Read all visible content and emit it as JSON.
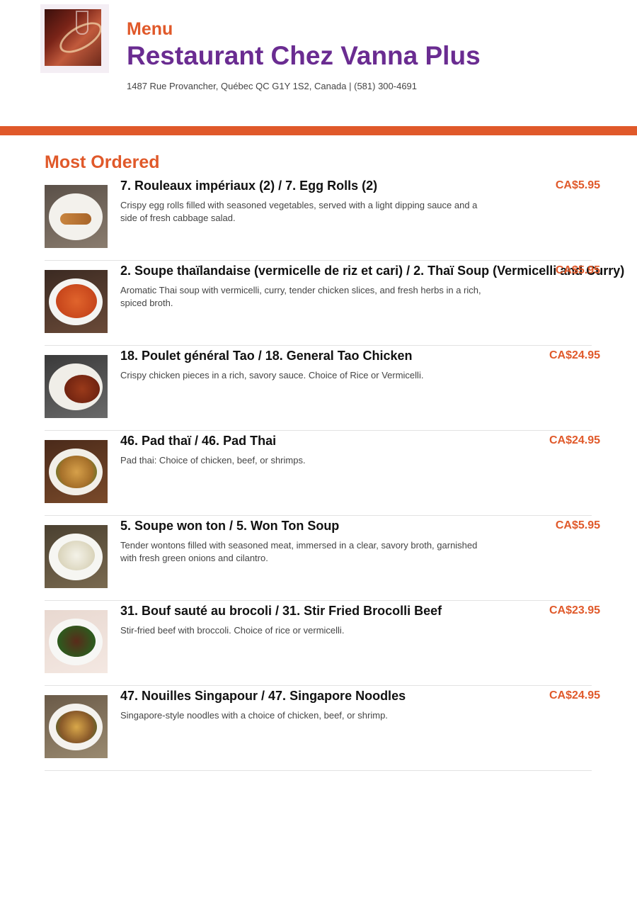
{
  "header": {
    "menu_label": "Menu",
    "restaurant_name": "Restaurant Chez Vanna Plus",
    "address_line": "1487 Rue Provancher, Québec QC G1Y 1S2, Canada | (581) 300-4691",
    "accent_color": "#e0592a",
    "title_color": "#6a2c91"
  },
  "section": {
    "title": "Most Ordered"
  },
  "items": [
    {
      "name": "7. Rouleaux impériaux (2) / 7. Egg Rolls (2)",
      "description": "Crispy egg rolls filled with seasoned vegetables, served with a light dipping sauce and a side of fresh cabbage salad.",
      "price": "CA$5.95"
    },
    {
      "name": "2. Soupe thaïlandaise (vermicelle de riz et cari) / 2. Thaï Soup (Vermicelli and Curry)",
      "description": "Aromatic Thai soup with vermicelli, curry, tender chicken slices, and fresh herbs in a rich, spiced broth.",
      "price": "CA$5.95"
    },
    {
      "name": "18. Poulet général Tao / 18. General Tao Chicken",
      "description": "Crispy chicken pieces in a rich, savory sauce. Choice of Rice or Vermicelli.",
      "price": "CA$24.95"
    },
    {
      "name": "46. Pad thaï / 46. Pad Thai",
      "description": "Pad thai: Choice of chicken, beef, or shrimps.",
      "price": "CA$24.95"
    },
    {
      "name": "5. Soupe won ton / 5. Won Ton Soup",
      "description": "Tender wontons filled with seasoned meat, immersed in a clear, savory broth, garnished with fresh green onions and cilantro.",
      "price": "CA$5.95"
    },
    {
      "name": "31. Bouf sauté au brocoli / 31. Stir Fried Brocolli Beef",
      "description": "Stir-fried beef with broccoli. Choice of rice or vermicelli.",
      "price": "CA$23.95"
    },
    {
      "name": "47. Nouilles Singapour / 47. Singapore Noodles",
      "description": "Singapore-style noodles with a choice of chicken, beef, or shrimp.",
      "price": "CA$24.95"
    }
  ]
}
